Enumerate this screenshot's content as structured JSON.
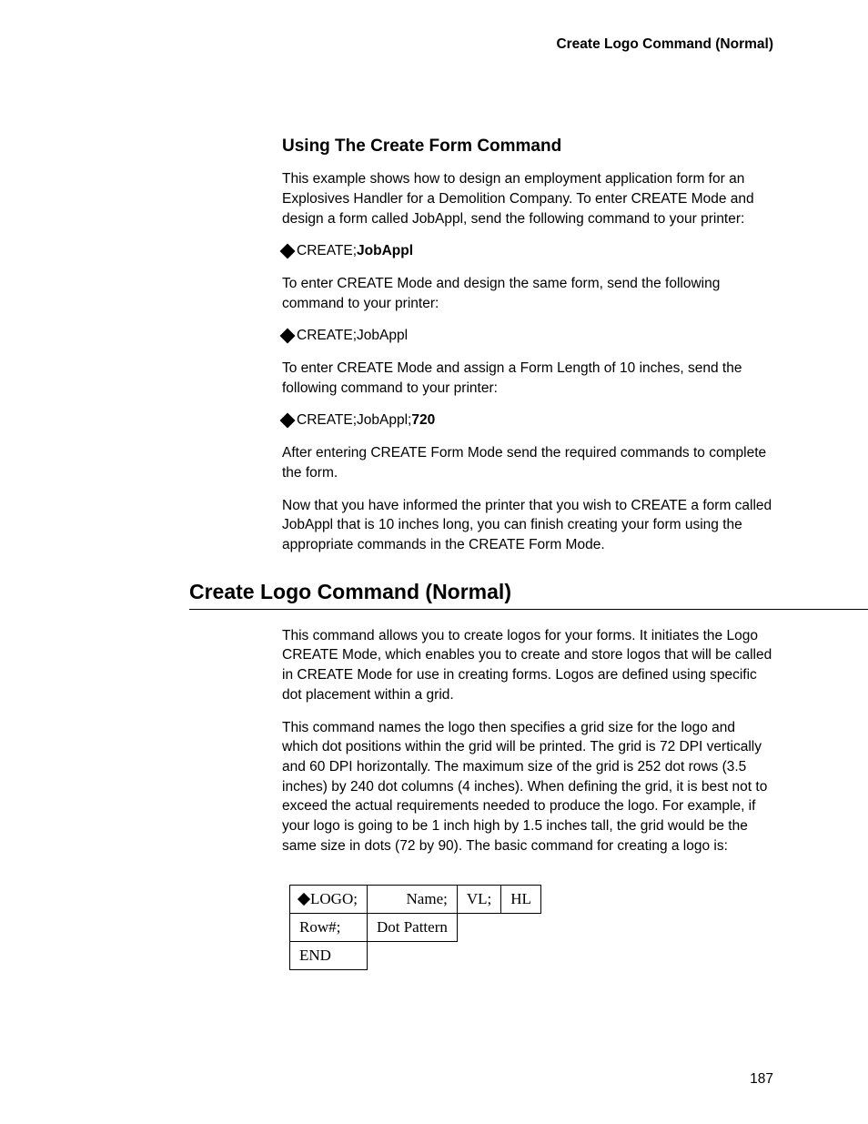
{
  "header": {
    "title": "Create Logo Command (Normal)"
  },
  "section1": {
    "heading": "Using The Create Form Command",
    "para1": "This example shows how to design an employment application form for an Explosives Handler for a Demolition Company. To enter CREATE Mode and design a form called JobAppl, send the following command to your printer:",
    "cmd1_prefix": "CREATE;",
    "cmd1_bold": "JobAppl",
    "para2": "To enter CREATE Mode and design the same form, send the following command to your printer:",
    "cmd2": "CREATE;JobAppl",
    "para3": "To enter CREATE Mode and assign a Form Length of 10 inches, send the following command to your printer:",
    "cmd3_prefix": "CREATE;JobAppl;",
    "cmd3_bold": "720",
    "para4": "After entering CREATE Form Mode send the required commands to complete the form.",
    "para5": "Now that you have informed the printer that you wish to CREATE a form called JobAppl that is 10 inches long, you can finish creating your form using the appropriate commands in the CREATE Form Mode."
  },
  "section2": {
    "heading": "Create Logo Command (Normal)",
    "para1": "This command allows you to create logos for your forms. It initiates the Logo CREATE Mode, which enables you to create and store logos that will be called in CREATE Mode for use in creating forms. Logos are defined using specific dot placement within a grid.",
    "para2": "This command names the logo then specifies a grid size for the logo and which dot positions within the grid will be printed. The grid is 72 DPI vertically and 60 DPI horizontally. The maximum size of the grid is 252 dot rows (3.5 inches) by 240 dot columns (4 inches). When defining the grid, it is best not to exceed the actual requirements needed to produce the logo. For example, if your logo is going to be 1 inch high by 1.5 inches tall, the grid would be the same size in dots (72 by 90). The basic command for creating a logo is:"
  },
  "table": {
    "r1c1": "LOGO;",
    "r1c2": "Name;",
    "r1c3": "VL;",
    "r1c4": "HL",
    "r2c1": "Row#;",
    "r2c2": "Dot Pattern",
    "r3c1": "END"
  },
  "page_number": "187"
}
